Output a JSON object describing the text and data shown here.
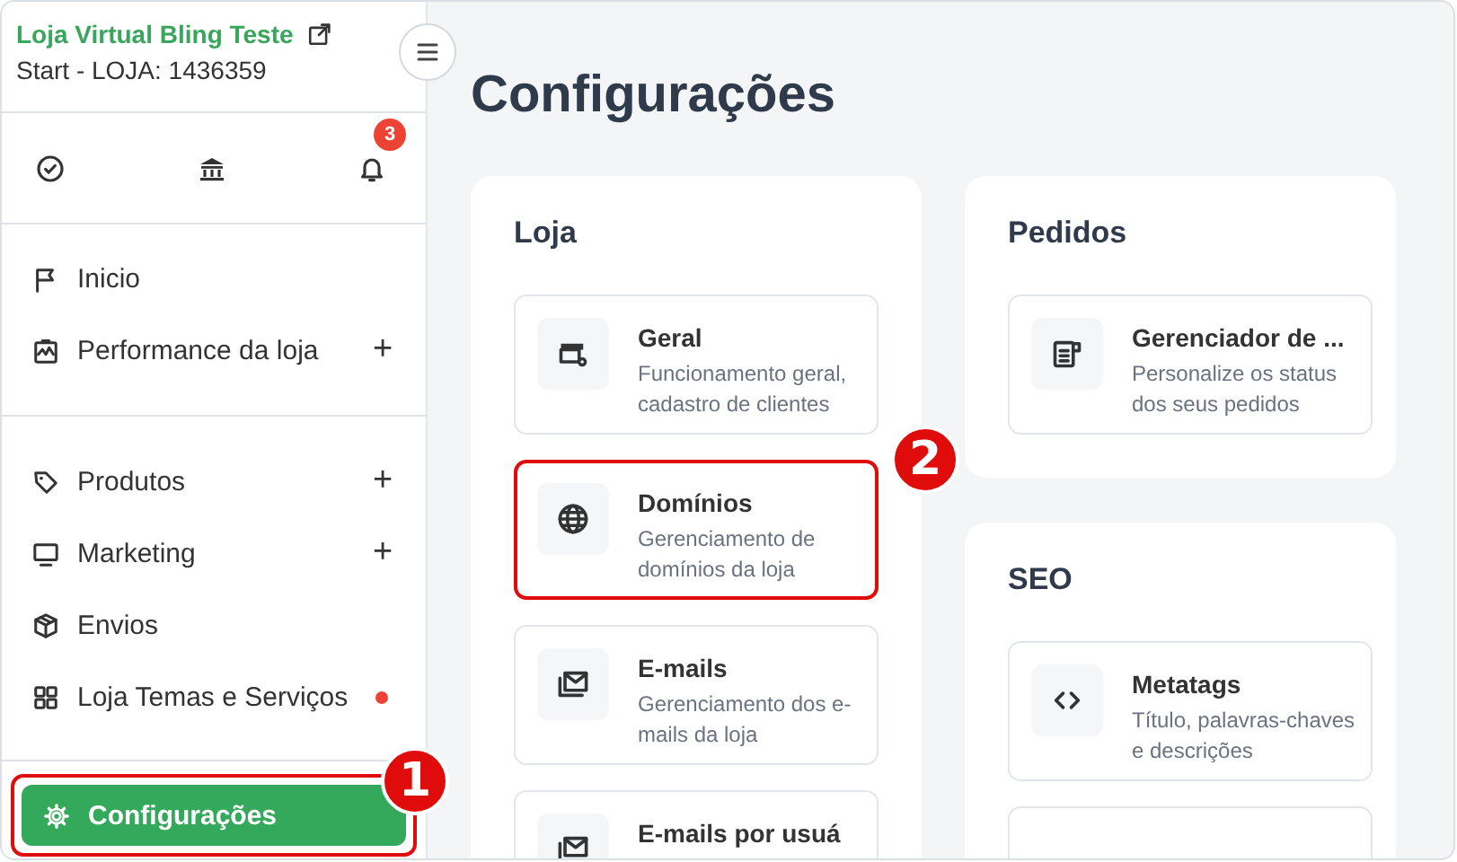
{
  "store": {
    "name": "Loja Virtual Bling Teste",
    "plan": "Start - LOJA: 1436359"
  },
  "notifications": {
    "badge": "3"
  },
  "nav_groups": [
    [
      {
        "label": "Inicio",
        "selected": false,
        "alert": false
      },
      {
        "label": "Performance da loja",
        "toggle": "+",
        "selected": false,
        "alert": false
      }
    ],
    [
      {
        "label": "Produtos",
        "toggle": "+",
        "selected": false,
        "alert": false
      },
      {
        "label": "Marketing",
        "toggle": "+",
        "selected": false,
        "alert": false
      },
      {
        "label": "Envios",
        "selected": false,
        "alert": false
      },
      {
        "label": "Loja Temas e Serviços",
        "selected": false,
        "alert": true
      }
    ],
    [
      {
        "label": "Configurações",
        "selected": true,
        "alert": false,
        "highlighted": true,
        "callout": "1"
      }
    ]
  ],
  "page_title": "Configurações",
  "columns": [
    [
      {
        "title": "Loja",
        "cards": [
          {
            "kind": "card",
            "title": "Geral",
            "description": "Funcionamento geral, cadastro de clientes",
            "highlighted": false
          },
          {
            "kind": "card",
            "title": "Domínios",
            "description": "Gerenciamento de domínios da loja",
            "highlighted": true,
            "callout": "2"
          },
          {
            "kind": "card",
            "title": "E-mails",
            "description": "Gerenciamento dos e-mails da loja",
            "highlighted": false
          },
          {
            "kind": "card",
            "title": "E-mails por usuá",
            "highlighted": false
          }
        ]
      }
    ],
    [
      {
        "title": "Pedidos",
        "cards": [
          {
            "kind": "card",
            "title": "Gerenciador de ...",
            "description": "Personalize os status dos seus pedidos",
            "highlighted": false
          }
        ]
      },
      {
        "title": "SEO",
        "cards": [
          {
            "kind": "card",
            "title": "Metatags",
            "description": "Título, palavras-chaves e descrições",
            "highlighted": false
          },
          {
            "kind": "empty",
            "highlighted": false
          }
        ]
      }
    ]
  ]
}
